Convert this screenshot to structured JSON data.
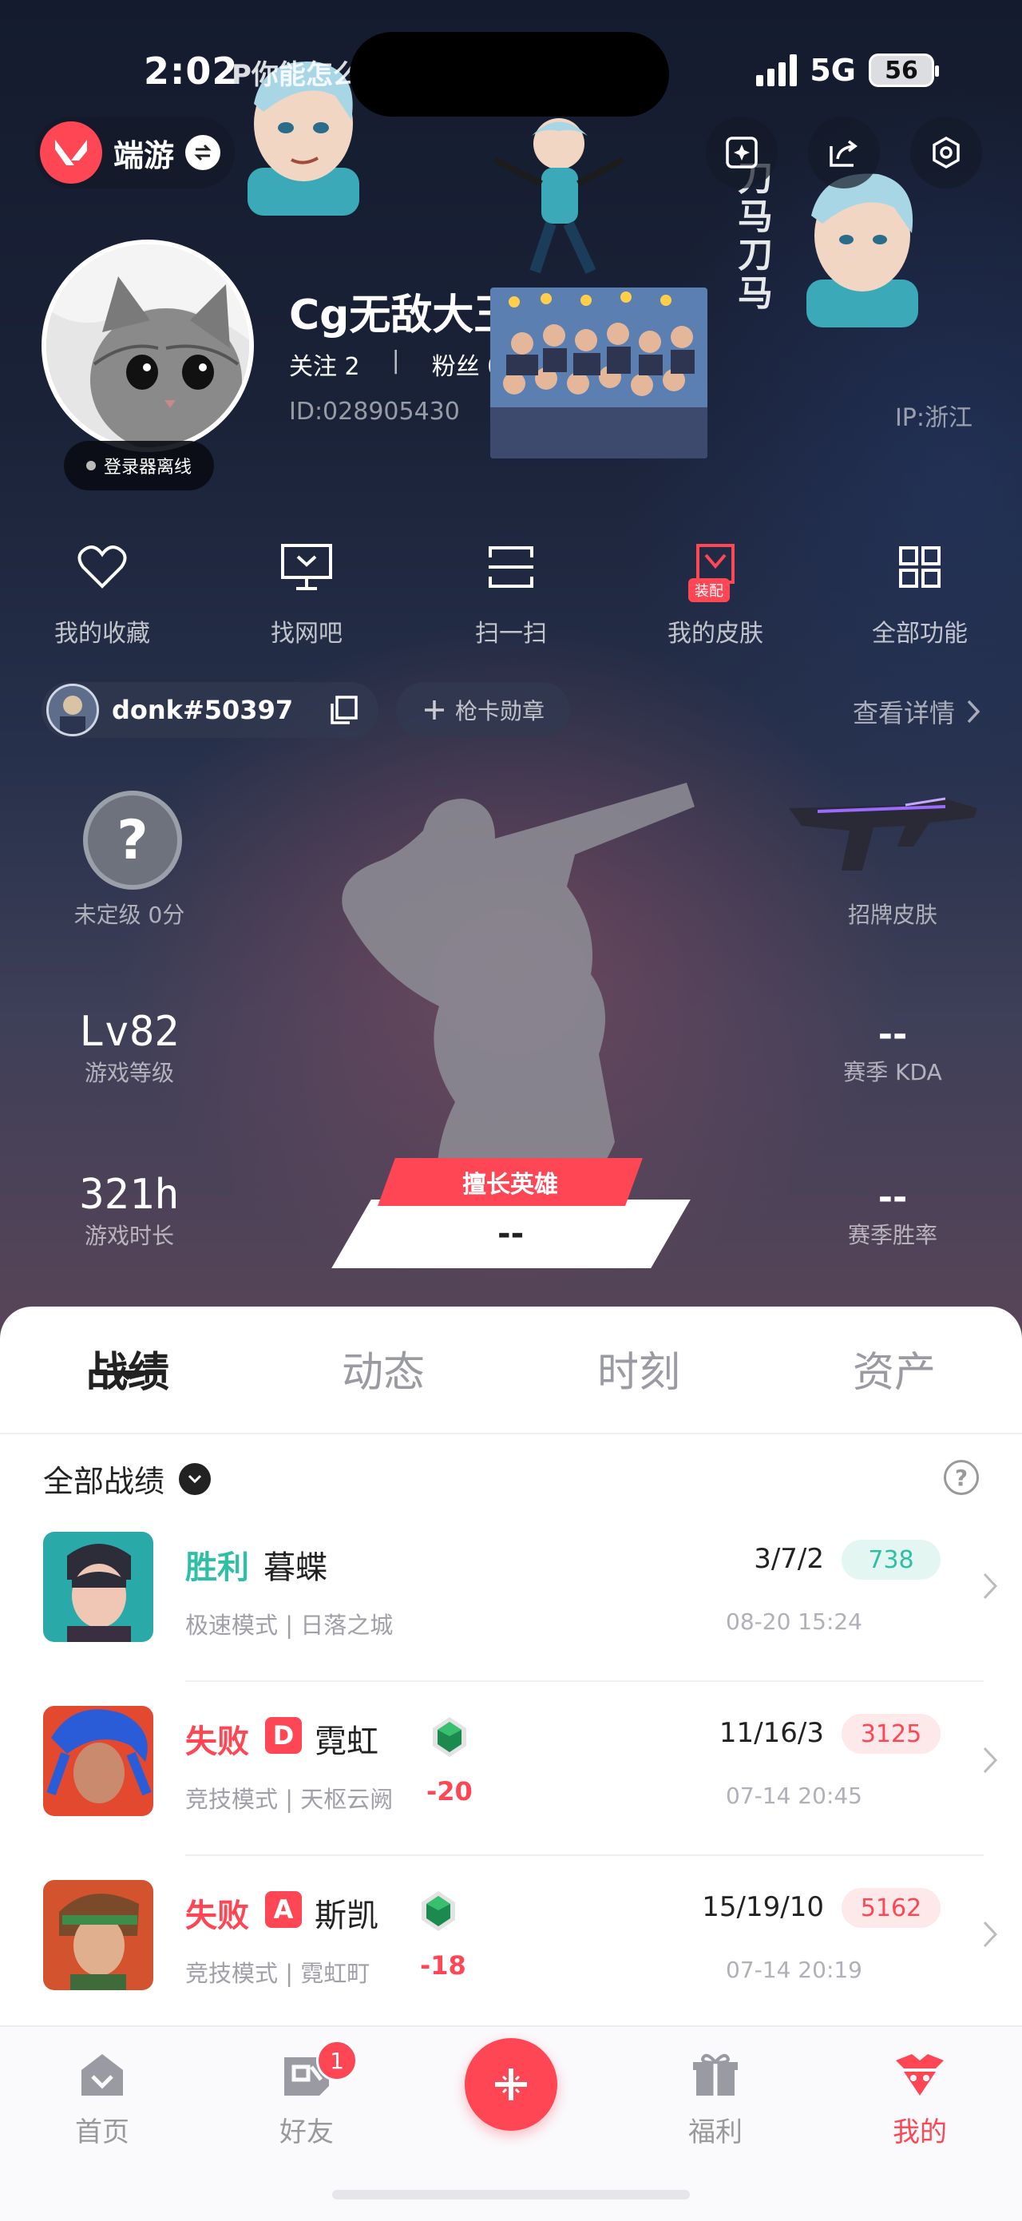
{
  "status_bar": {
    "time": "2:02",
    "network": "5G",
    "battery": "56"
  },
  "app": {
    "name": "端游"
  },
  "stickers": {
    "text": "P你能怎么",
    "hand_text": "刀马刀马"
  },
  "profile": {
    "nickname": "Cg无敌大王",
    "follow_label": "关注 2",
    "separator": "|",
    "fans_label": "粉丝 0",
    "uid": "ID:028905430",
    "ip": "IP:浙江",
    "online_status": "登录器离线"
  },
  "quick_actions": [
    {
      "label": "我的收藏",
      "icon": "heart-icon"
    },
    {
      "label": "找网吧",
      "icon": "monitor-icon"
    },
    {
      "label": "扫一扫",
      "icon": "scan-icon"
    },
    {
      "label": "我的皮肤",
      "icon": "skin-icon",
      "tag": "装配"
    },
    {
      "label": "全部功能",
      "icon": "grid-icon"
    }
  ],
  "riot": {
    "id": "donk#50397",
    "card_label": "枪卡勋章",
    "detail_link": "查看详情"
  },
  "stats": {
    "rank_label": "未定级 0分",
    "rank_icon_text": "?",
    "level_value": "Lv82",
    "level_label": "游戏等级",
    "hours_value": "321h",
    "hours_label": "游戏时长",
    "skin_label": "招牌皮肤",
    "kda_value": "--",
    "kda_label": "赛季 KDA",
    "winrate_value": "--",
    "winrate_label": "赛季胜率",
    "best_agent_tag": "擅长英雄",
    "best_agent_value": "--"
  },
  "tabs": [
    "战绩",
    "动态",
    "时刻",
    "资产"
  ],
  "filter": {
    "label": "全部战绩",
    "help": "?"
  },
  "matches": [
    {
      "result": "胜利",
      "rank_letter": "",
      "agent": "暮蝶",
      "mode_map": "极速模式 | 日落之城",
      "rr_change": "",
      "kda": "3/7/2",
      "acs": "738",
      "time": "08-20 15:24",
      "outcome": "win"
    },
    {
      "result": "失败",
      "rank_letter": "D",
      "agent": "霓虹",
      "mode_map": "竞技模式 | 天枢云阙",
      "rr_change": "-20",
      "kda": "11/16/3",
      "acs": "3125",
      "time": "07-14 20:45",
      "outcome": "lose"
    },
    {
      "result": "失败",
      "rank_letter": "A",
      "agent": "斯凯",
      "mode_map": "竞技模式 | 霓虹町",
      "rr_change": "-18",
      "kda": "15/19/10",
      "acs": "5162",
      "time": "07-14 20:19",
      "outcome": "lose"
    }
  ],
  "bottom_nav": {
    "items": [
      {
        "label": "首页",
        "icon": "home-icon"
      },
      {
        "label": "好友",
        "icon": "friends-icon",
        "badge": "1"
      },
      {
        "label": "福利",
        "icon": "gift-icon"
      },
      {
        "label": "我的",
        "icon": "profile-icon"
      }
    ],
    "fab_icon": "plus-icon"
  },
  "colors": {
    "accent": "#ff4655",
    "win": "#2fbfa5",
    "hero_bg": "#1a2238"
  }
}
